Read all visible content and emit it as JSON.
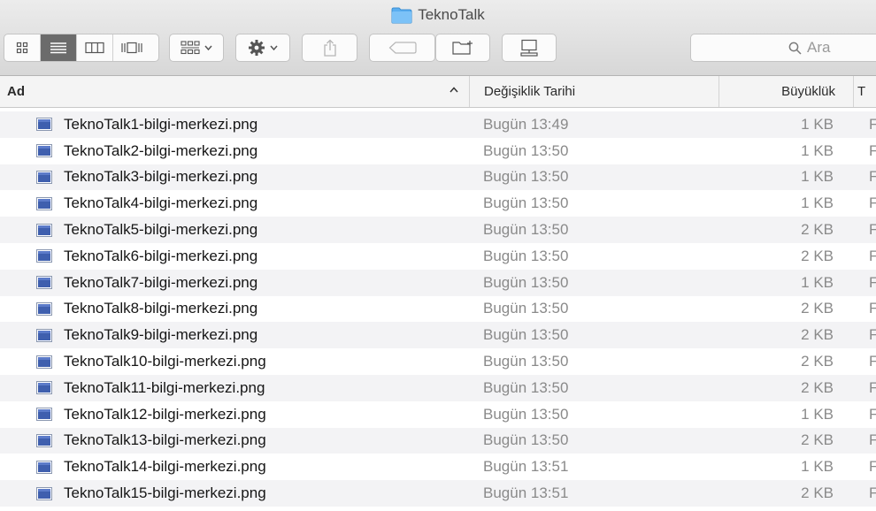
{
  "window": {
    "title": "TeknoTalk",
    "title_icon": "folder-icon",
    "accent": "#4a90d9"
  },
  "toolbar": {
    "view_modes": [
      {
        "name": "icon-view",
        "icon": "grid-icon",
        "active": false
      },
      {
        "name": "list-view",
        "icon": "list-icon",
        "active": true
      },
      {
        "name": "column-view",
        "icon": "columns-icon",
        "active": false
      },
      {
        "name": "coverflow-view",
        "icon": "coverflow-icon",
        "active": false
      }
    ],
    "arrange": {
      "icon": "arrange-grid-icon"
    },
    "action": {
      "icon": "gear-icon"
    },
    "share": {
      "icon": "share-icon"
    },
    "tags": {
      "icon": "tag-icon"
    },
    "new_folder": {
      "icon": "new-folder-icon"
    },
    "connect": {
      "icon": "desktop-icon"
    },
    "search": {
      "placeholder": "Ara",
      "icon": "search-icon"
    }
  },
  "columns": {
    "name": "Ad",
    "date": "Değişiklik Tarihi",
    "size": "Büyüklük",
    "kind": "T",
    "sort_indicator": "^"
  },
  "files": [
    {
      "name": "TeknoTalk1-bilgi-merkezi.png",
      "date": "Bugün 13:49",
      "size": "1 KB",
      "kind": "F"
    },
    {
      "name": "TeknoTalk2-bilgi-merkezi.png",
      "date": "Bugün 13:50",
      "size": "1 KB",
      "kind": "F"
    },
    {
      "name": "TeknoTalk3-bilgi-merkezi.png",
      "date": "Bugün 13:50",
      "size": "1 KB",
      "kind": "F"
    },
    {
      "name": "TeknoTalk4-bilgi-merkezi.png",
      "date": "Bugün 13:50",
      "size": "1 KB",
      "kind": "F"
    },
    {
      "name": "TeknoTalk5-bilgi-merkezi.png",
      "date": "Bugün 13:50",
      "size": "2 KB",
      "kind": "F"
    },
    {
      "name": "TeknoTalk6-bilgi-merkezi.png",
      "date": "Bugün 13:50",
      "size": "2 KB",
      "kind": "F"
    },
    {
      "name": "TeknoTalk7-bilgi-merkezi.png",
      "date": "Bugün 13:50",
      "size": "1 KB",
      "kind": "F"
    },
    {
      "name": "TeknoTalk8-bilgi-merkezi.png",
      "date": "Bugün 13:50",
      "size": "2 KB",
      "kind": "F"
    },
    {
      "name": "TeknoTalk9-bilgi-merkezi.png",
      "date": "Bugün 13:50",
      "size": "2 KB",
      "kind": "F"
    },
    {
      "name": "TeknoTalk10-bilgi-merkezi.png",
      "date": "Bugün 13:50",
      "size": "2 KB",
      "kind": "F"
    },
    {
      "name": "TeknoTalk11-bilgi-merkezi.png",
      "date": "Bugün 13:50",
      "size": "2 KB",
      "kind": "F"
    },
    {
      "name": "TeknoTalk12-bilgi-merkezi.png",
      "date": "Bugün 13:50",
      "size": "1 KB",
      "kind": "F"
    },
    {
      "name": "TeknoTalk13-bilgi-merkezi.png",
      "date": "Bugün 13:50",
      "size": "2 KB",
      "kind": "F"
    },
    {
      "name": "TeknoTalk14-bilgi-merkezi.png",
      "date": "Bugün 13:51",
      "size": "1 KB",
      "kind": "F"
    },
    {
      "name": "TeknoTalk15-bilgi-merkezi.png",
      "date": "Bugün 13:51",
      "size": "2 KB",
      "kind": "F"
    }
  ]
}
